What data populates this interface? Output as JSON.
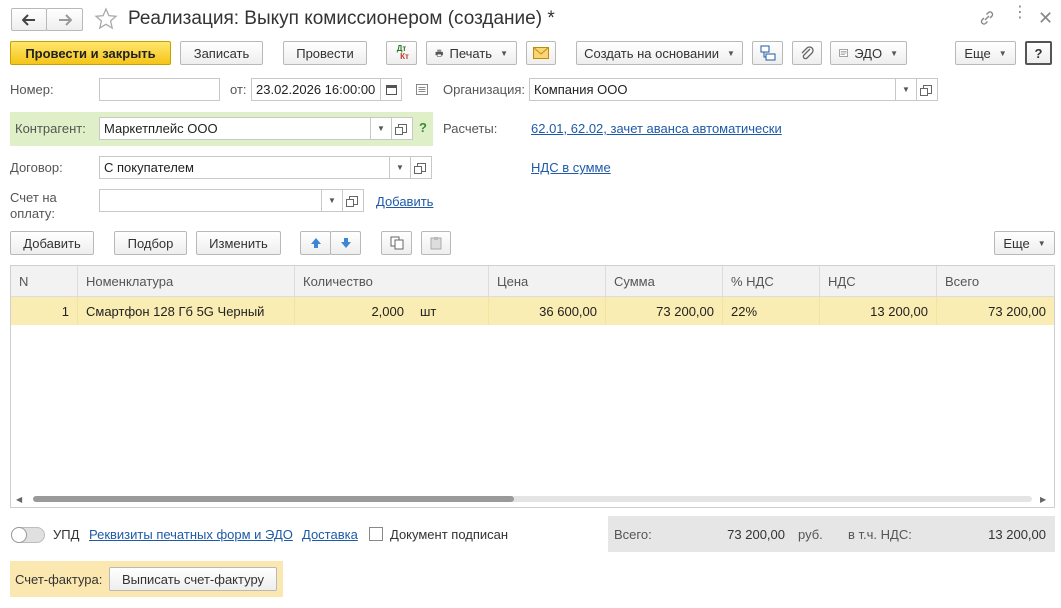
{
  "window": {
    "title": "Реализация: Выкуп комиссионером (создание) *"
  },
  "toolbar": {
    "post_close": "Провести и закрыть",
    "save": "Записать",
    "post": "Провести",
    "dt_kt_top": "Дт",
    "dt_kt_bottom": "Кт",
    "print": "Печать",
    "create_based": "Создать на основании",
    "edo": "ЭДО",
    "more": "Еще",
    "help": "?"
  },
  "form": {
    "number_label": "Номер:",
    "number_value": "",
    "date_label": "от:",
    "date_value": "23.02.2026 16:00:00",
    "org_label": "Организация:",
    "org_value": "Компания ООО",
    "counterparty_label": "Контрагент:",
    "counterparty_value": "Маркетплейс ООО",
    "counterparty_help": "?",
    "settlements_label": "Расчеты:",
    "settlements_link": "62.01, 62.02, зачет аванса автоматически",
    "contract_label": "Договор:",
    "contract_value": "С покупателем",
    "vat_link": "НДС в сумме",
    "invoice_label": "Счет на оплату:",
    "invoice_value": "",
    "add_link": "Добавить"
  },
  "table_toolbar": {
    "add": "Добавить",
    "selection": "Подбор",
    "change": "Изменить",
    "more": "Еще"
  },
  "table": {
    "headers": [
      "N",
      "Номенклатура",
      "Количество",
      "Цена",
      "Сумма",
      "% НДС",
      "НДС",
      "Всего"
    ],
    "rows": [
      {
        "n": "1",
        "item": "Смартфон 128 Гб 5G Черный",
        "qty": "2,000",
        "unit": "шт",
        "price": "36 600,00",
        "sum": "73 200,00",
        "vat_rate": "22%",
        "vat": "13 200,00",
        "total": "73 200,00"
      }
    ]
  },
  "footer": {
    "upd_label": "УПД",
    "print_forms_link": "Реквизиты печатных форм и ЭДО",
    "delivery_link": "Доставка",
    "signed_label": "Документ подписан",
    "total_label": "Всего:",
    "total_value": "73 200,00",
    "currency": "руб.",
    "vat_incl_label": "в т.ч. НДС:",
    "vat_incl_value": "13 200,00",
    "invoice_fact_label": "Счет-фактура:",
    "invoice_fact_button": "Выписать счет-фактуру"
  },
  "colors": {
    "primary_button": "#f5c518",
    "link": "#1e5aa8",
    "selected_row": "#faedb3",
    "counterparty_bg": "#dff0c8",
    "invoice_bg": "#fbe8b0"
  }
}
